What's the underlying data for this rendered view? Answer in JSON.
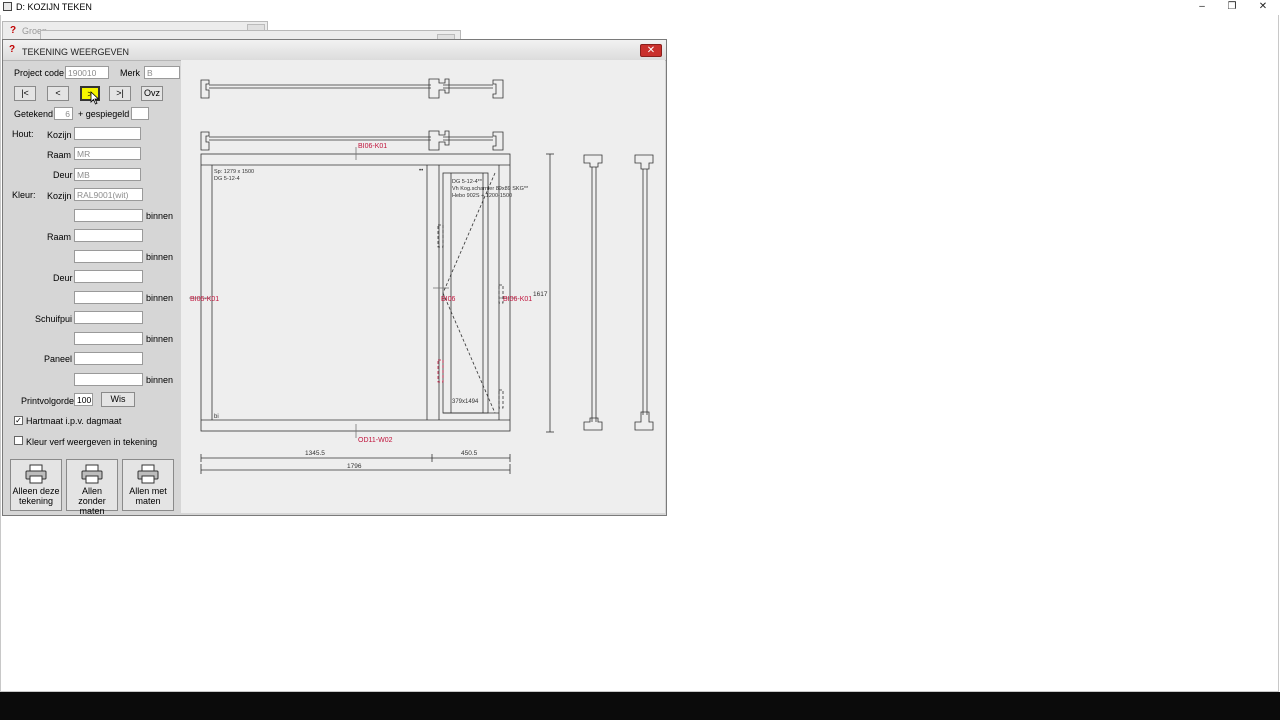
{
  "app": {
    "title": "D: KOZIJN TEKEN",
    "minimize": "–",
    "maximize": "❐",
    "close": "✕"
  },
  "background_dialogs": {
    "first_title": "Groen"
  },
  "dialog": {
    "title": "TEKENING WEERGEVEN",
    "close": "✕",
    "project_code_label": "Project code",
    "project_code_value": "190010",
    "merk_label": "Merk",
    "merk_value": "B",
    "nav": {
      "first": "|<",
      "prev": "<",
      "next": ">",
      "last": ">|",
      "overview": "Ovz"
    },
    "getekend_label": "Getekend",
    "getekend_value": "6",
    "gespiegeld_label": "+ gespiegeld",
    "gespiegeld_value": "",
    "hout_label": "Hout:",
    "hout_kozijn_label": "Kozijn",
    "hout_kozijn_value": "",
    "hout_raam_label": "Raam",
    "hout_raam_value": "MR",
    "hout_deur_label": "Deur",
    "hout_deur_value": "MB",
    "kleur_label": "Kleur:",
    "kleur_kozijn_label": "Kozijn",
    "kleur_kozijn_value": "RAL9001(wit)",
    "binnen_label": "binnen",
    "kleur_raam_label": "Raam",
    "kleur_deur_label": "Deur",
    "kleur_schuifpui_label": "Schuifpui",
    "kleur_paneel_label": "Paneel",
    "printvolgorde_label": "Printvolgorde",
    "printvolgorde_value": "100",
    "wis_label": "Wis",
    "hartmaat_label": "Hartmaat i.p.v. dagmaat",
    "hartmaat_checked": true,
    "kleur_verf_label": "Kleur verf weergeven in tekening",
    "kleur_verf_checked": false,
    "print_buttons": [
      {
        "line1": "Alleen deze",
        "line2": "tekening"
      },
      {
        "line1": "Allen zonder",
        "line2": "maten"
      },
      {
        "line1": "Allen met",
        "line2": "maten"
      }
    ]
  },
  "drawing": {
    "label_top": "BI06-K01",
    "label_left": "BI06-K01",
    "label_mid": "BI06",
    "label_right": "BI06-K01",
    "label_bottom": "OD11-W02",
    "left_pane_line1": "Sp: 1279 x 1500",
    "left_pane_line2": "DG 5-12-4",
    "left_pane_bottom": "bi",
    "door_line1": "DG 5-12-4**",
    "door_line2": "Vh Kog.scharnier 89x89 SKG**",
    "door_line3": "Hebo 902S + 1200-1500",
    "door_size": "379x1494",
    "height_dim": "1617",
    "dim_left": "1345.5",
    "dim_right": "450.5",
    "dim_total": "1796",
    "door_marks": "••",
    "colors": {
      "label_red": "#c0143c",
      "line": "#333333"
    }
  }
}
